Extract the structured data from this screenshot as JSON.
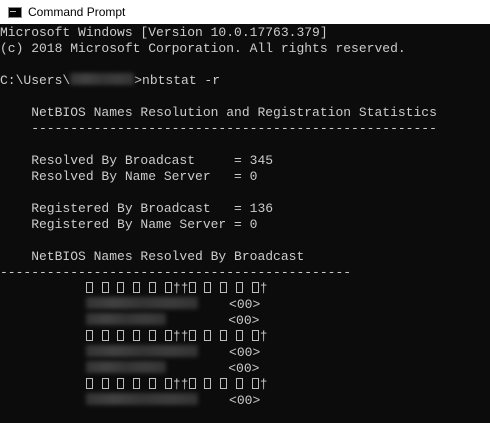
{
  "window": {
    "title": "Command Prompt",
    "icon": "console-icon"
  },
  "console": {
    "banner1": "Microsoft Windows [Version 10.0.17763.379]",
    "banner2": "(c) 2018 Microsoft Corporation. All rights reserved.",
    "prompt_prefix": "C:\\Users\\",
    "prompt_suffix": ">nbtstat -r",
    "heading1": "    NetBIOS Names Resolution and Registration Statistics",
    "divider1": "    ----------------------------------------------------",
    "resolved_broadcast": "    Resolved By Broadcast     = 345",
    "resolved_name_server": "    Resolved By Name Server   = 0",
    "registered_broadcast": "    Registered By Broadcast   = 136",
    "registered_name_server": "    Registered By Name Server = 0",
    "heading2": "    NetBIOS Names Resolved By Broadcast",
    "divider2": "---------------------------------------------",
    "entries": [
      {
        "garbled_a": "††",
        "garbled_b": "†",
        "suffix1": "<00>",
        "suffix2": "<00>"
      },
      {
        "garbled_a": "††",
        "garbled_b": "†",
        "suffix1": "<00>",
        "suffix2": "<00>"
      },
      {
        "garbled_a": "††",
        "garbled_b": "†",
        "suffix1": "<00>"
      }
    ]
  },
  "colors": {
    "console_bg": "#0c0c0c",
    "console_text": "#cccccc",
    "titlebar_bg": "#ffffff"
  }
}
